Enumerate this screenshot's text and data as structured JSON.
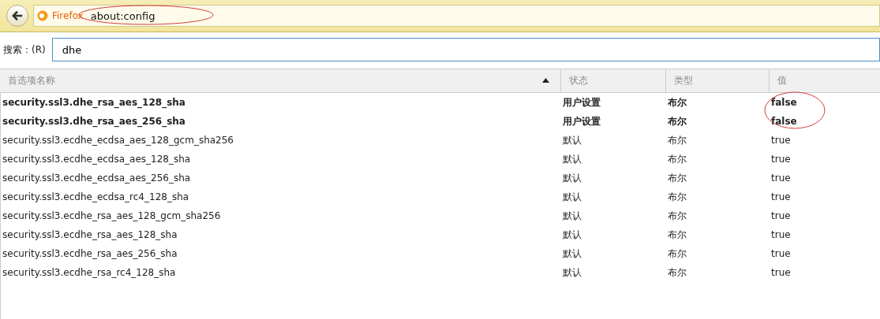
{
  "toolbar": {
    "identity": "Firefox",
    "address": "about:config",
    "address_circled": true
  },
  "search": {
    "label": "搜索：(R)",
    "value": "dhe"
  },
  "table": {
    "columns": [
      {
        "label": "首选项名称",
        "sorted": true
      },
      {
        "label": "状态",
        "sorted": false
      },
      {
        "label": "类型",
        "sorted": false
      },
      {
        "label": "值",
        "sorted": false
      }
    ],
    "rows": [
      {
        "name": "security.ssl3.dhe_rsa_aes_128_sha",
        "status": "用户设置",
        "type": "布尔",
        "value": "false",
        "modified": true
      },
      {
        "name": "security.ssl3.dhe_rsa_aes_256_sha",
        "status": "用户设置",
        "type": "布尔",
        "value": "false",
        "modified": true
      },
      {
        "name": "security.ssl3.ecdhe_ecdsa_aes_128_gcm_sha256",
        "status": "默认",
        "type": "布尔",
        "value": "true",
        "modified": false
      },
      {
        "name": "security.ssl3.ecdhe_ecdsa_aes_128_sha",
        "status": "默认",
        "type": "布尔",
        "value": "true",
        "modified": false
      },
      {
        "name": "security.ssl3.ecdhe_ecdsa_aes_256_sha",
        "status": "默认",
        "type": "布尔",
        "value": "true",
        "modified": false
      },
      {
        "name": "security.ssl3.ecdhe_ecdsa_rc4_128_sha",
        "status": "默认",
        "type": "布尔",
        "value": "true",
        "modified": false
      },
      {
        "name": "security.ssl3.ecdhe_rsa_aes_128_gcm_sha256",
        "status": "默认",
        "type": "布尔",
        "value": "true",
        "modified": false
      },
      {
        "name": "security.ssl3.ecdhe_rsa_aes_128_sha",
        "status": "默认",
        "type": "布尔",
        "value": "true",
        "modified": false
      },
      {
        "name": "security.ssl3.ecdhe_rsa_aes_256_sha",
        "status": "默认",
        "type": "布尔",
        "value": "true",
        "modified": false
      },
      {
        "name": "security.ssl3.ecdhe_rsa_rc4_128_sha",
        "status": "默认",
        "type": "布尔",
        "value": "true",
        "modified": false
      }
    ],
    "values_circled": true
  }
}
